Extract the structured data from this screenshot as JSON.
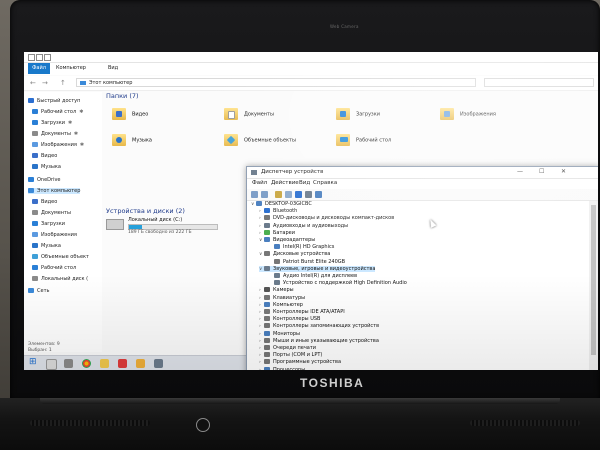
{
  "laptop": {
    "brand": "TOSHIBA",
    "webcam_label": "Web Camera"
  },
  "explorer": {
    "ribbon_tabs": [
      "Файл",
      "Компьютер",
      "Вид"
    ],
    "address": "Этот компьютер",
    "nav_back": "←",
    "nav_forward": "→",
    "nav_up": "↑",
    "nav": [
      {
        "label": "Быстрый доступ",
        "icon": "star-icon",
        "color": "#2b6fd1"
      },
      {
        "label": "Рабочий стол",
        "icon": "desktop-icon",
        "color": "#2a7fd6",
        "pinned": true
      },
      {
        "label": "Загрузки",
        "icon": "download-icon",
        "color": "#2a7fd6",
        "pinned": true
      },
      {
        "label": "Документы",
        "icon": "documents-icon",
        "color": "#8a8a8a",
        "pinned": true
      },
      {
        "label": "Изображения",
        "icon": "pictures-icon",
        "color": "#5b9ae0",
        "pinned": true
      },
      {
        "label": "Видео",
        "icon": "video-icon",
        "color": "#3b6fc9"
      },
      {
        "label": "Музыка",
        "icon": "music-icon",
        "color": "#2a74c9"
      },
      {
        "label": "OneDrive",
        "icon": "cloud-icon",
        "color": "#2a7fd6"
      },
      {
        "label": "Этот компьютер",
        "icon": "computer-icon",
        "color": "#3b8ad9",
        "selected": true
      },
      {
        "label": "Видео",
        "icon": "video-icon",
        "color": "#3b6fc9"
      },
      {
        "label": "Документы",
        "icon": "documents-icon",
        "color": "#8a8a8a"
      },
      {
        "label": "Загрузки",
        "icon": "download-icon",
        "color": "#2a7fd6"
      },
      {
        "label": "Изображения",
        "icon": "pictures-icon",
        "color": "#5b9ae0"
      },
      {
        "label": "Музыка",
        "icon": "music-icon",
        "color": "#2a74c9"
      },
      {
        "label": "Объемные объект",
        "icon": "3d-objects-icon",
        "color": "#3fa0d8"
      },
      {
        "label": "Рабочий стол",
        "icon": "desktop-icon",
        "color": "#2a7fd6"
      },
      {
        "label": "Локальный диск (",
        "icon": "drive-icon",
        "color": "#8a8a8a"
      },
      {
        "label": "Сеть",
        "icon": "network-icon",
        "color": "#3b8ad9"
      }
    ],
    "status": {
      "items": "Элементов: 9",
      "selected": "Выбран: 1"
    },
    "folders_header": "Папки (7)",
    "folders": [
      {
        "label": "Видео",
        "icon": "video-icon"
      },
      {
        "label": "Документы",
        "icon": "documents-icon"
      },
      {
        "label": "Загрузки",
        "icon": "downloads-icon"
      },
      {
        "label": "Изображения",
        "icon": "pictures-icon"
      },
      {
        "label": "Музыка",
        "icon": "music-icon"
      },
      {
        "label": "Объемные объекты",
        "icon": "3d-objects-icon"
      },
      {
        "label": "Рабочий стол",
        "icon": "desktop-icon"
      }
    ],
    "devices_header": "Устройства и диски (2)",
    "drive": {
      "name": "Локальный диск (C:)",
      "free": "189 ГБ свободно из 222 ГБ",
      "used_fraction": 0.15
    },
    "dvd_label": "DVD"
  },
  "devmgr": {
    "title": "Диспетчер устройств",
    "controls": {
      "minimize": "—",
      "maximize": "☐",
      "close": "✕"
    },
    "menu": [
      "Файл",
      "Действие",
      "Вид",
      "Справка"
    ],
    "tree": [
      {
        "label": "DESKTOP-03GICBC",
        "level": 0,
        "expander": "∨",
        "icon": "computer-icon",
        "color": "#4a7fbf"
      },
      {
        "label": "Bluetooth",
        "level": 1,
        "expander": "›",
        "icon": "bluetooth-icon",
        "color": "#2a6fd0"
      },
      {
        "label": "DVD-дисководы и дисководы компакт-дисков",
        "level": 1,
        "expander": "›",
        "icon": "dvd-drive-icon",
        "color": "#777"
      },
      {
        "label": "Аудиовходы и аудиовыходы",
        "level": 1,
        "expander": "›",
        "icon": "audio-icon",
        "color": "#6b7b8c"
      },
      {
        "label": "Батареи",
        "level": 1,
        "expander": "›",
        "icon": "battery-icon",
        "color": "#4caf50"
      },
      {
        "label": "Видеоадаптеры",
        "level": 1,
        "expander": "∨",
        "icon": "display-adapter-icon",
        "color": "#4a7fbf"
      },
      {
        "label": "Intel(R) HD Graphics",
        "level": 2,
        "expander": "",
        "icon": "display-adapter-icon",
        "color": "#4a7fbf"
      },
      {
        "label": "Дисковые устройства",
        "level": 1,
        "expander": "∨",
        "icon": "disk-icon",
        "color": "#777"
      },
      {
        "label": "Patriot Burst Elite 240GB",
        "level": 2,
        "expander": "",
        "icon": "disk-icon",
        "color": "#777"
      },
      {
        "label": "Звуковые, игровые и видеоустройства",
        "level": 1,
        "expander": "∨",
        "icon": "sound-icon",
        "color": "#6b7b8c",
        "selected": true
      },
      {
        "label": "Аудио Intel(R) для дисплеев",
        "level": 2,
        "expander": "",
        "icon": "sound-icon",
        "color": "#6b7b8c"
      },
      {
        "label": "Устройство с поддержкой High Definition Audio",
        "level": 2,
        "expander": "",
        "icon": "sound-icon",
        "color": "#6b7b8c"
      },
      {
        "label": "Камеры",
        "level": 1,
        "expander": "›",
        "icon": "camera-icon",
        "color": "#555"
      },
      {
        "label": "Клавиатуры",
        "level": 1,
        "expander": "›",
        "icon": "keyboard-icon",
        "color": "#777"
      },
      {
        "label": "Компьютер",
        "level": 1,
        "expander": "›",
        "icon": "computer-icon",
        "color": "#4a7fbf"
      },
      {
        "label": "Контроллеры IDE ATA/ATAPI",
        "level": 1,
        "expander": "›",
        "icon": "controller-icon",
        "color": "#777"
      },
      {
        "label": "Контроллеры USB",
        "level": 1,
        "expander": "›",
        "icon": "usb-icon",
        "color": "#777"
      },
      {
        "label": "Контроллеры запоминающих устройств",
        "level": 1,
        "expander": "›",
        "icon": "storage-controller-icon",
        "color": "#777"
      },
      {
        "label": "Мониторы",
        "level": 1,
        "expander": "›",
        "icon": "monitor-icon",
        "color": "#4a7fbf"
      },
      {
        "label": "Мыши и иные указывающие устройства",
        "level": 1,
        "expander": "›",
        "icon": "mouse-icon",
        "color": "#777"
      },
      {
        "label": "Очереди печати",
        "level": 1,
        "expander": "›",
        "icon": "printer-icon",
        "color": "#777"
      },
      {
        "label": "Порты (COM и LPT)",
        "level": 1,
        "expander": "›",
        "icon": "port-icon",
        "color": "#777"
      },
      {
        "label": "Программные устройства",
        "level": 1,
        "expander": "›",
        "icon": "software-device-icon",
        "color": "#777"
      },
      {
        "label": "Процессоры",
        "level": 1,
        "expander": "›",
        "icon": "processor-icon",
        "color": "#4a7fbf"
      }
    ]
  }
}
